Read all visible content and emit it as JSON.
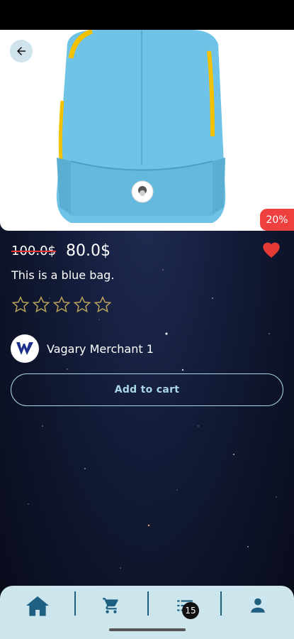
{
  "product": {
    "old_price": "100.0$",
    "new_price": "80.0$",
    "discount": "20%",
    "description": "This is a blue bag.",
    "rating": 0,
    "rating_max": 5,
    "image_icon": "backpack-photo"
  },
  "merchant": {
    "name": "Vagary Merchant 1",
    "logo_icon": "merchant-w-logo"
  },
  "actions": {
    "add_to_cart_label": "Add to cart",
    "back_icon": "arrow-left-icon",
    "favorite_icon": "heart-icon"
  },
  "nav": {
    "items": [
      {
        "icon": "home-icon",
        "active": true
      },
      {
        "icon": "cart-icon",
        "active": false
      },
      {
        "icon": "orders-list-icon",
        "active": false
      },
      {
        "icon": "profile-icon",
        "active": false
      }
    ],
    "orders_badge": "15"
  },
  "colors": {
    "accent": "#a8d6e3",
    "nav_icon": "#1e5f82",
    "discount_badge": "#ef4040",
    "heart": "#e53935",
    "bag_blue": "#6fc3e6",
    "bag_trim": "#f2c200"
  }
}
